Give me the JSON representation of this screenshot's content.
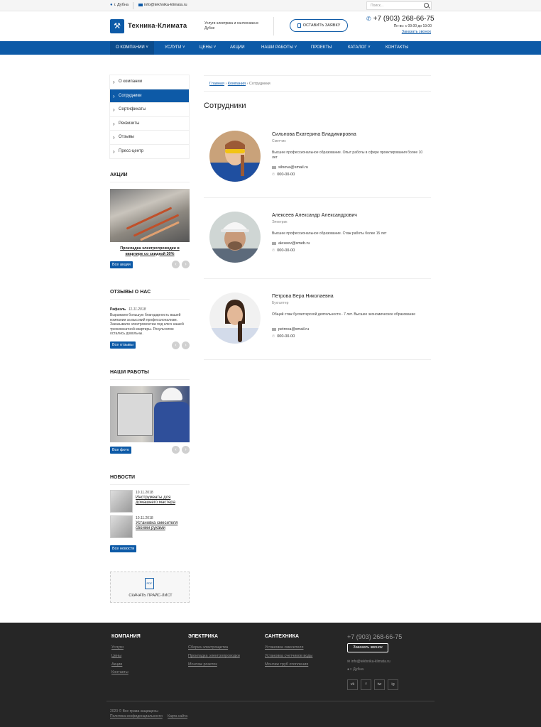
{
  "topbar": {
    "city": "г. Дубна",
    "email": "info@tekhnika-klimata.ru",
    "search_placeholder": "Поиск..."
  },
  "header": {
    "logo_text": "Техника-Климата",
    "tagline": "Услуги электрика и сантехника в Дубне",
    "cta_label": "ОСТАВИТЬ ЗАЯВКУ",
    "phone": "+7 (903) 268-66-75",
    "hours": "Пн-вс: с 09.00 до 19.00",
    "callback": "Заказать звонок"
  },
  "nav": [
    "О КОМПАНИИ",
    "УСЛУГИ",
    "ЦЕНЫ",
    "АКЦИИ",
    "НАШИ РАБОТЫ",
    "ПРОЕКТЫ",
    "КАТАЛОГ",
    "КОНТАКТЫ"
  ],
  "sidebar": {
    "menu": [
      "О компании",
      "Сотрудники",
      "Сертификаты",
      "Реквизиты",
      "Отзывы",
      "Пресс-центр"
    ],
    "promo_title": "АКЦИИ",
    "promo_caption": "Прокладка электропроводки в квартире со скидкой 30%",
    "promo_button": "Все акции",
    "reviews_title": "ОТЗЫВЫ О НАС",
    "review_author": "Рафаэль",
    "review_date": "11.11.2018",
    "review_text": "Выражаем большую благодарность вашей компании за высокий профессионализм. Заказывали электромонтаж под ключ нашей трехкомнатной квартиры. Результатом остались довольны.",
    "reviews_button": "Все отзывы",
    "works_title": "НАШИ РАБОТЫ",
    "works_button": "Все фото",
    "news_title": "НОВОСТИ",
    "news": [
      {
        "date": "10.11.2018",
        "title": "Инструменты для домашнего мастера"
      },
      {
        "date": "10.11.2018",
        "title": "Установка смесителя своими руками"
      }
    ],
    "news_button": "Все новости",
    "pricelist_label": "СКАЧАТЬ ПРАЙС-ЛИСТ",
    "pdf_icon_text": "PDF"
  },
  "main": {
    "breadcrumbs": [
      "Главная",
      "Компания",
      "Сотрудники"
    ],
    "title": "Сотрудники",
    "employees": [
      {
        "name": "Сильнова Екатерина Владимировна",
        "role": "Сметчик",
        "desc": "Высшее профессиональное образование. Опыт работы в сфере проектирования более 10 лет",
        "email": "silnova@smail.ru",
        "phone": "000-00-00"
      },
      {
        "name": "Алексеев Александр Александрович",
        "role": "Электрик",
        "desc": "Высшее профессиональное образование. Стаж работы более 15 лет",
        "email": "alexeev@smeb.ru",
        "phone": "000-00-00"
      },
      {
        "name": "Петрова Вера Николаевна",
        "role": "Бухгалтер",
        "desc": "Общий стаж бухгалтерской деятельности - 7 лет. Высшее экономическое образование",
        "email": "petrova@smail.ru",
        "phone": "000-00-00"
      }
    ]
  },
  "footer": {
    "col1_title": "КОМПАНИЯ",
    "col1_links": [
      "Услуги",
      "Цены",
      "Акции",
      "Контакты"
    ],
    "col2_title": "ЭЛЕКТРИКА",
    "col2_links": [
      "Сборка электрощитка",
      "Прокладка электропроводки",
      "Монтаж розеток"
    ],
    "col3_title": "САНТЕХНИКА",
    "col3_links": [
      "Установка смесителя",
      "Установка счетчиков воды",
      "Монтаж труб отопления"
    ],
    "phone": "+7 (903) 268-66-75",
    "callback": "Заказать звонок",
    "email": "info@tekhnika-klimata.ru",
    "city": "г. Дубна",
    "social": [
      "vk",
      "f",
      "tw",
      "ig"
    ],
    "copyright": "2020 © Все права защищены",
    "privacy": "Политика конфиденциальности",
    "sitemap": "Карта сайта"
  },
  "colors": {
    "brand": "#0d5aa7",
    "footer_bg": "#262626"
  }
}
